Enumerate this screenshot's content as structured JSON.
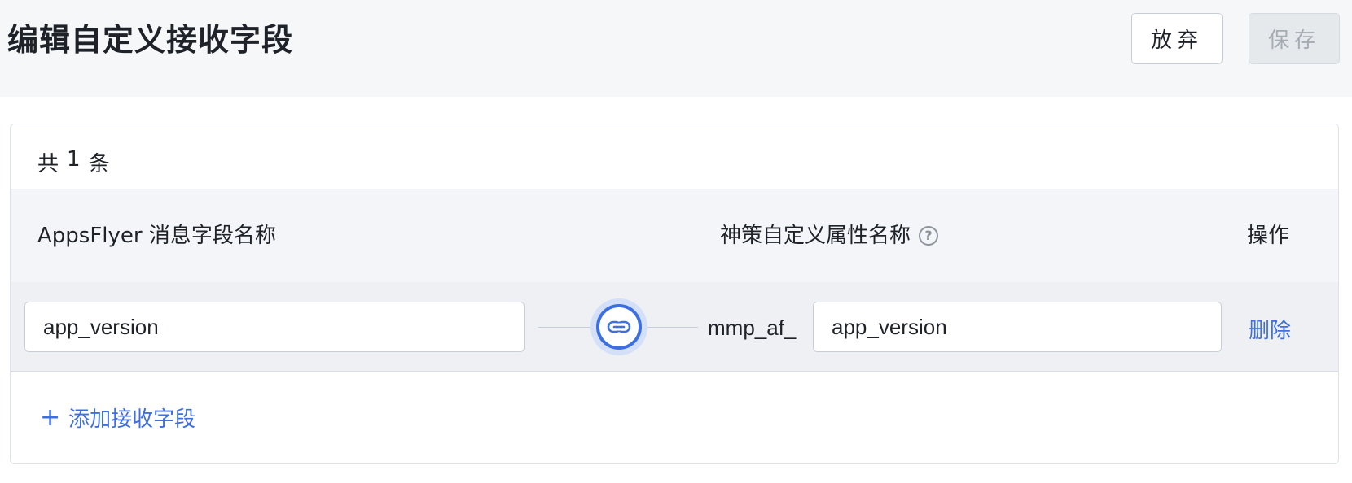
{
  "header": {
    "title": "编辑自定义接收字段",
    "discard_label": "放弃",
    "save_label": "保存"
  },
  "summary": {
    "prefix": "共",
    "count": "1",
    "suffix": "条"
  },
  "table": {
    "columns": {
      "source": "AppsFlyer 消息字段名称",
      "target": "神策自定义属性名称",
      "actions": "操作"
    },
    "rows": [
      {
        "source_value": "app_version",
        "target_prefix": "mmp_af_",
        "target_value": "app_version",
        "delete_label": "删除"
      }
    ]
  },
  "add_field_label": "添加接收字段",
  "icons": {
    "help": "help-circle-icon",
    "link": "link-icon",
    "plus": "plus-icon"
  },
  "colors": {
    "accent": "#3d6fe0",
    "header_bg": "#f5f7f9"
  }
}
